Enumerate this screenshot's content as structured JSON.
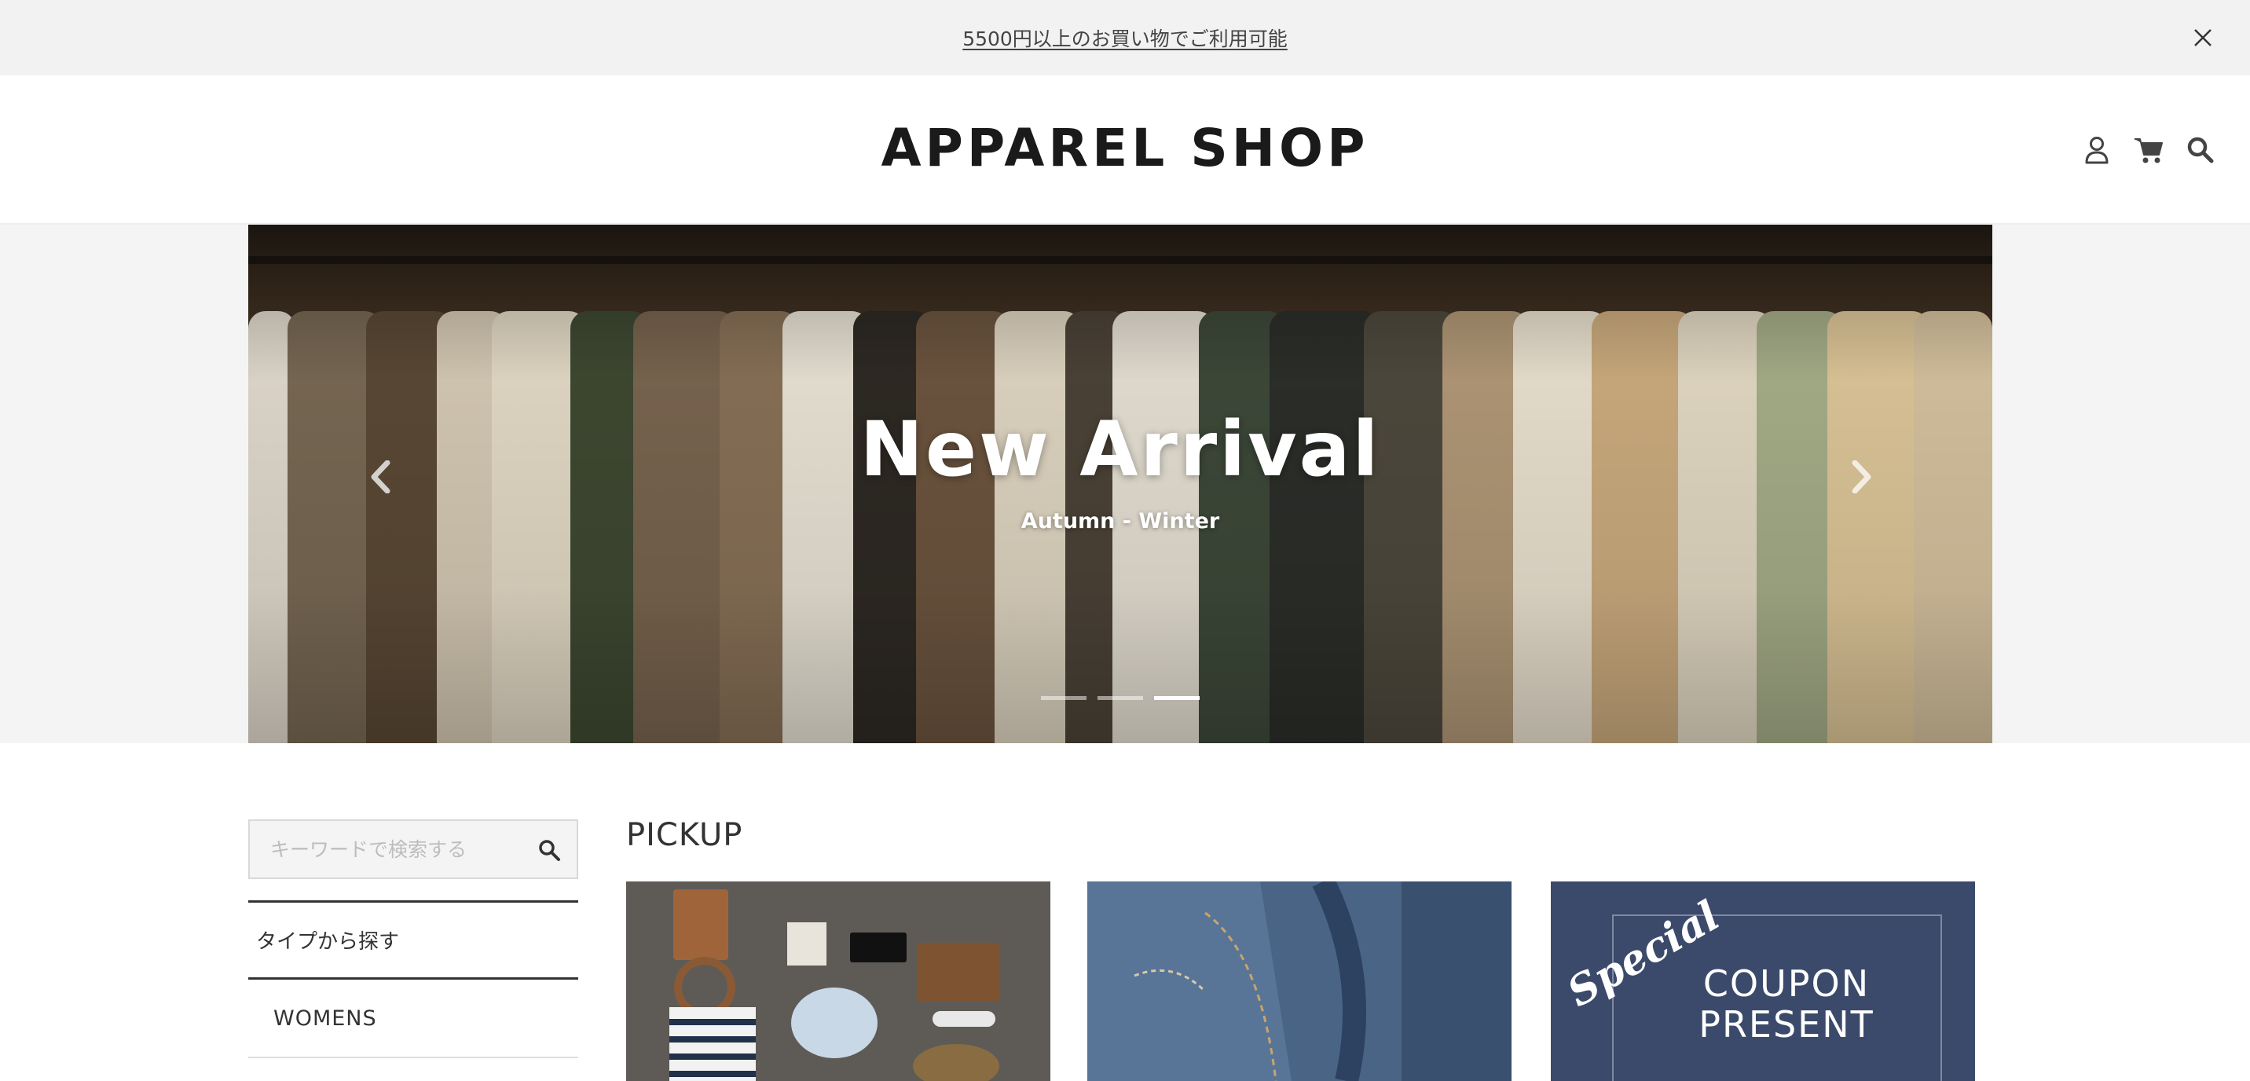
{
  "announcement": {
    "text": "5500円以上のお買い物でご利用可能"
  },
  "header": {
    "logo": "APPAREL SHOP",
    "icons": [
      "user-icon",
      "cart-icon",
      "search-icon"
    ]
  },
  "hero": {
    "title": "New Arrival",
    "subtitle": "Autumn - Winter",
    "slide_count": 3,
    "active_slide": 3
  },
  "sidebar": {
    "search_placeholder": "キーワードで検索する",
    "heading": "タイプから探す",
    "items": [
      {
        "label": "WOMENS"
      }
    ]
  },
  "pickup": {
    "title": "PICKUP",
    "cards": [
      {
        "kind": "flatlay-photo"
      },
      {
        "kind": "denim-photo"
      },
      {
        "special": "Special",
        "line1": "COUPON",
        "line2": "PRESENT"
      }
    ]
  }
}
